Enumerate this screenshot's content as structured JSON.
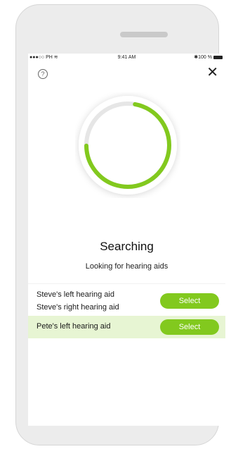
{
  "status_bar": {
    "carrier": "●●●○○ PH ≋",
    "time": "9:41 AM",
    "battery": "✱100 %"
  },
  "header": {
    "help_icon": "?",
    "close_icon": "✕"
  },
  "progress": {
    "fraction": 0.72,
    "accent_color": "#82c91e",
    "track_color": "#e6e6e6"
  },
  "main": {
    "title": "Searching",
    "subtitle": "Looking for hearing aids"
  },
  "devices": [
    {
      "names": [
        "Steve's left hearing aid",
        "Steve's right hearing aid"
      ],
      "button_label": "Select",
      "highlighted": false
    },
    {
      "names": [
        "Pete's left hearing aid"
      ],
      "button_label": "Select",
      "highlighted": true
    }
  ],
  "colors": {
    "accent": "#82c91e",
    "highlight_row": "#e7f5d3"
  }
}
